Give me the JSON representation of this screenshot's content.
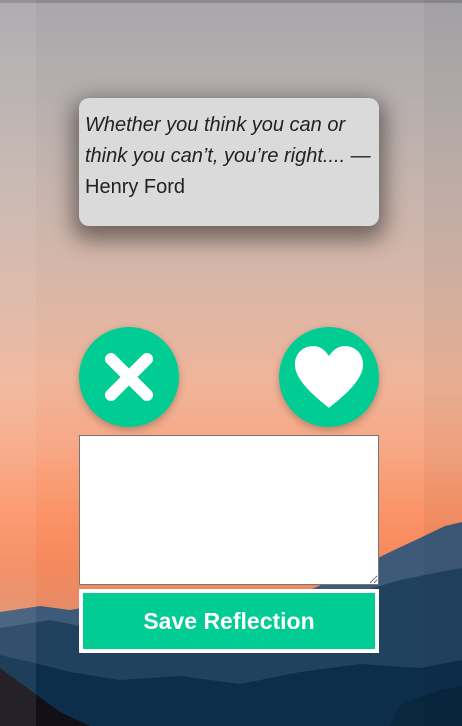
{
  "quote": {
    "text": "Whether you think you can or think you can’t, you’re right.... —",
    "author": "Henry Ford"
  },
  "actions": {
    "dismiss_icon": "close-icon",
    "like_icon": "heart-icon",
    "accent_color": "#00cc94"
  },
  "reflection": {
    "value": "",
    "placeholder": ""
  },
  "save_button": {
    "label": "Save Reflection"
  }
}
